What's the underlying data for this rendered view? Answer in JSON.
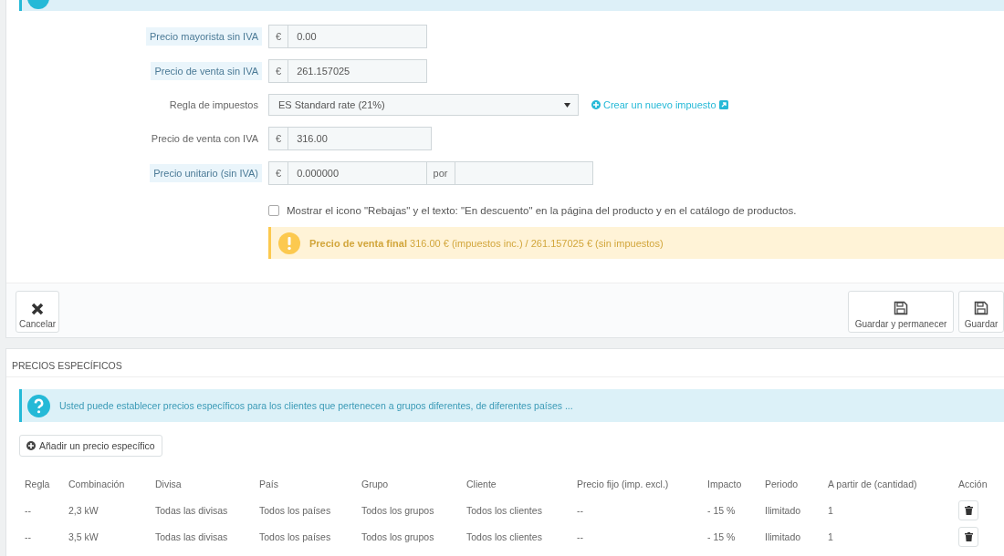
{
  "fields": [
    {
      "kind": "money",
      "label": "Precio mayorista sin IVA",
      "hint": true,
      "prefix": "€",
      "value": "0.00"
    },
    {
      "kind": "money",
      "label": "Precio de venta sin IVA",
      "hint": true,
      "prefix": "€",
      "value": "261.157025"
    },
    {
      "kind": "select",
      "label": "Regla de impuestos",
      "hint": false,
      "value": "ES Standard rate (21%)",
      "link": "Crear un nuevo impuesto"
    },
    {
      "kind": "money",
      "label": "Precio de venta con IVA",
      "hint": false,
      "prefix": "€",
      "value": "316.00"
    },
    {
      "kind": "unit",
      "label": "Precio unitario (sin IVA)",
      "hint": true,
      "prefix": "€",
      "value": "0.000000",
      "suffix": "por"
    }
  ],
  "on_sale": {
    "checked": false,
    "label": "Mostrar el icono \"Rebajas\" y el texto: \"En descuento\" en la página del producto y en el catálogo de productos."
  },
  "final_price": "**Precio de venta final** 316.00 € (impuestos inc.) / 261.157025 € (sin impuestos)",
  "footer": {
    "cancel": "Cancelar",
    "save_stay": "Guardar y permanecer",
    "save": "Guardar"
  },
  "specific_prices": {
    "title": "PRECIOS ESPECÍFICOS",
    "info": "Usted puede establecer precios específicos para los clientes que pertenecen a grupos diferentes, de diferentes países ...",
    "add_button": "Añadir un precio específico",
    "columns": [
      "Regla",
      "Combinación",
      "Divisa",
      "País",
      "Grupo",
      "Cliente",
      "Precio fijo (imp. excl.)",
      "Impacto",
      "Periodo",
      "A partir de (cantidad)",
      "Acción"
    ],
    "rows": [
      [
        "--",
        "2,3 kW",
        "Todas las divisas",
        "Todos los países",
        "Todos los grupos",
        "Todos los clientes",
        "--",
        "- 15 %",
        "Ilimitado",
        "1"
      ],
      [
        "--",
        "3,5 kW",
        "Todas las divisas",
        "Todos los países",
        "Todos los grupos",
        "Todos los clientes",
        "--",
        "- 15 %",
        "Ilimitado",
        "1"
      ]
    ]
  }
}
